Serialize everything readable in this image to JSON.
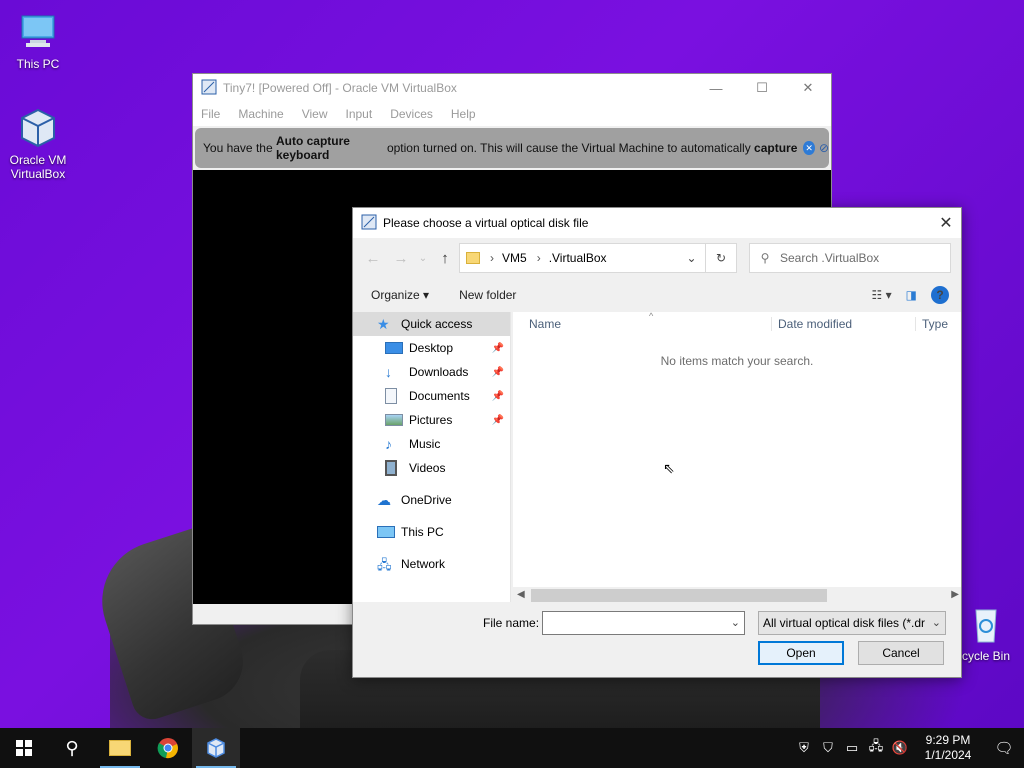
{
  "desktop": {
    "icons": [
      {
        "label": "This PC",
        "icon": "monitor-icon"
      },
      {
        "label": "Oracle VM VirtualBox",
        "icon": "virtualbox-icon"
      },
      {
        "label": "cycle Bin",
        "icon": "recycle-bin-icon"
      }
    ]
  },
  "vbox_window": {
    "title": "Tiny7! [Powered Off] - Oracle VM VirtualBox",
    "menu": [
      "File",
      "Machine",
      "View",
      "Input",
      "Devices",
      "Help"
    ],
    "notice_pre": "You have the ",
    "notice_bold1": "Auto capture keyboard",
    "notice_mid": " option turned on. This will cause the Virtual Machine to automatically ",
    "notice_bold2": "capture"
  },
  "dialog": {
    "title": "Please choose a virtual optical disk file",
    "breadcrumb": [
      "VM5",
      ".VirtualBox"
    ],
    "search_placeholder": "Search .VirtualBox",
    "toolbar": {
      "organize": "Organize",
      "new_folder": "New folder"
    },
    "nav": [
      {
        "label": "Quick access",
        "icon": "star-icon",
        "pinned": false,
        "selected": true
      },
      {
        "label": "Desktop",
        "icon": "desktop-folder-icon",
        "pinned": true
      },
      {
        "label": "Downloads",
        "icon": "download-arrow-icon",
        "pinned": true
      },
      {
        "label": "Documents",
        "icon": "document-icon",
        "pinned": true
      },
      {
        "label": "Pictures",
        "icon": "picture-icon",
        "pinned": true
      },
      {
        "label": "Music",
        "icon": "music-note-icon",
        "pinned": false
      },
      {
        "label": "Videos",
        "icon": "film-icon",
        "pinned": false
      },
      {
        "label": "OneDrive",
        "icon": "cloud-icon",
        "pinned": false
      },
      {
        "label": "This PC",
        "icon": "monitor-icon",
        "pinned": false
      },
      {
        "label": "Network",
        "icon": "network-icon",
        "pinned": false
      }
    ],
    "columns": [
      "Name",
      "Date modified",
      "Type"
    ],
    "empty_message": "No items match your search.",
    "file_name_label": "File name:",
    "file_name_value": "",
    "filter": "All virtual optical disk files (*.dr",
    "open_label": "Open",
    "cancel_label": "Cancel"
  },
  "taskbar": {
    "time": "9:29 PM",
    "date": "1/1/2024"
  }
}
